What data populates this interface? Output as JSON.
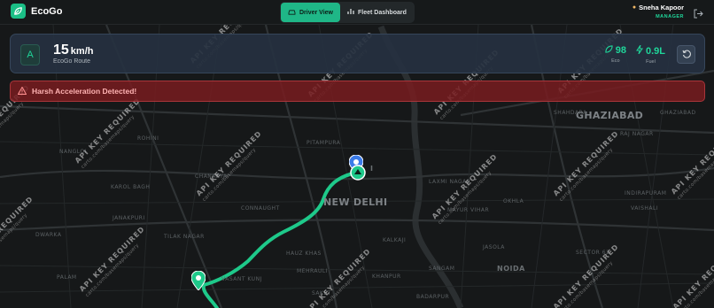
{
  "app": {
    "name": "EcoGo"
  },
  "view_tabs": [
    {
      "label": "Driver View",
      "active": true,
      "icon": "car-icon"
    },
    {
      "label": "Fleet Dashboard",
      "active": false,
      "icon": "chart-icon"
    }
  ],
  "user": {
    "name": "Sneha Kapoor",
    "role": "MANAGER",
    "avatar_icon": "person-icon"
  },
  "status": {
    "direction": "A",
    "speed": "15",
    "speed_unit": "km/h",
    "route": "EcoGo Route",
    "eco_score": "98",
    "eco_label": "Eco",
    "fuel": "0.9L",
    "fuel_label": "Fuel"
  },
  "alert": {
    "text": "Harsh Acceleration Detected!",
    "icon": "warning-icon"
  },
  "map": {
    "watermark_title": "API KEY REQUIRED",
    "watermark_sub": "carto.com/basemaps/query",
    "labels": {
      "city_main": "NEW DELHI",
      "city_ghaziabad": "GHAZIABAD",
      "city_noida": "NOIDA",
      "delhi_partial": "I"
    },
    "small_labels": [
      "SHAHDARA",
      "GHAZIABAD",
      "LAXMI NAGAR",
      "PALAM",
      "DWARKA",
      "SAKET",
      "VASANT KUNJ",
      "RAJ NAGAR",
      "INDIRAPURAM",
      "VAISHALI",
      "KAROL BAGH",
      "CONNAUGHT",
      "MAYUR VIHAR",
      "KALKAJI",
      "OKHLA",
      "JANAKPURI",
      "ROHINI",
      "PITAMPURA",
      "NANGLOI",
      "TILAK NAGAR",
      "SECTOR 62",
      "KHANPUR",
      "HAUZ KHAS",
      "MEHRAULI",
      "BADARPUR",
      "SANGAM",
      "JASOLA",
      "CHANAKYA"
    ]
  },
  "colors": {
    "accent": "#1fb787",
    "alert_bg": "#781c20",
    "alert_text": "#ffb3b3",
    "route": "#1ec98a",
    "start_pin": "#3b7be8"
  }
}
